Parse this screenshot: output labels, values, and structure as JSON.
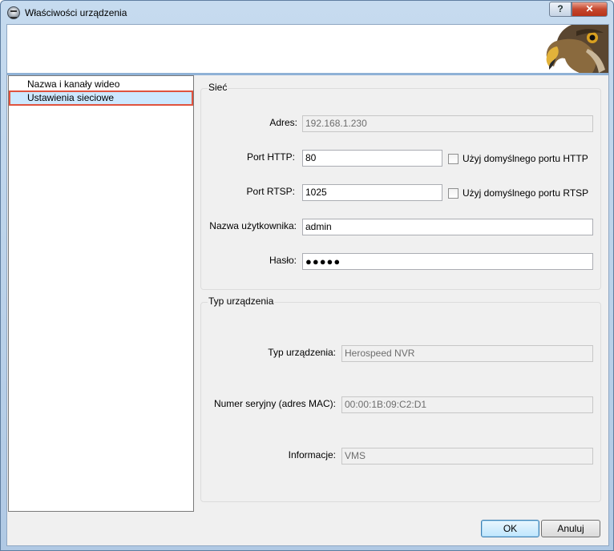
{
  "window": {
    "title": "Właściwości urządzenia",
    "help_label": "?",
    "close_label": "✕"
  },
  "nav": {
    "items": [
      {
        "label": "Nazwa i kanały wideo",
        "selected": false
      },
      {
        "label": "Ustawienia sieciowe",
        "selected": true
      }
    ]
  },
  "network": {
    "group_title": "Sieć",
    "address_label": "Adres:",
    "address_value": "192.168.1.230",
    "http_label": "Port HTTP:",
    "http_value": "80",
    "http_default_label": "Użyj domyślnego portu HTTP",
    "rtsp_label": "Port RTSP:",
    "rtsp_value": "1025",
    "rtsp_default_label": "Użyj domyślnego portu RTSP",
    "user_label": "Nazwa użytkownika:",
    "user_value": "admin",
    "password_label": "Hasło:",
    "password_value": "●●●●●"
  },
  "device": {
    "group_title": "Typ urządzenia",
    "type_label": "Typ urządzenia:",
    "type_value": "Herospeed NVR",
    "serial_label": "Numer seryjny (adres MAC):",
    "serial_value": "00:00:1B:09:C2:D1",
    "info_label": "Informacje:",
    "info_value": "VMS"
  },
  "buttons": {
    "ok": "OK",
    "cancel": "Anuluj"
  },
  "colors": {
    "selection_bg": "#cde8ff",
    "selection_border": "#e0533f",
    "client_bg": "#f0f0f0"
  }
}
